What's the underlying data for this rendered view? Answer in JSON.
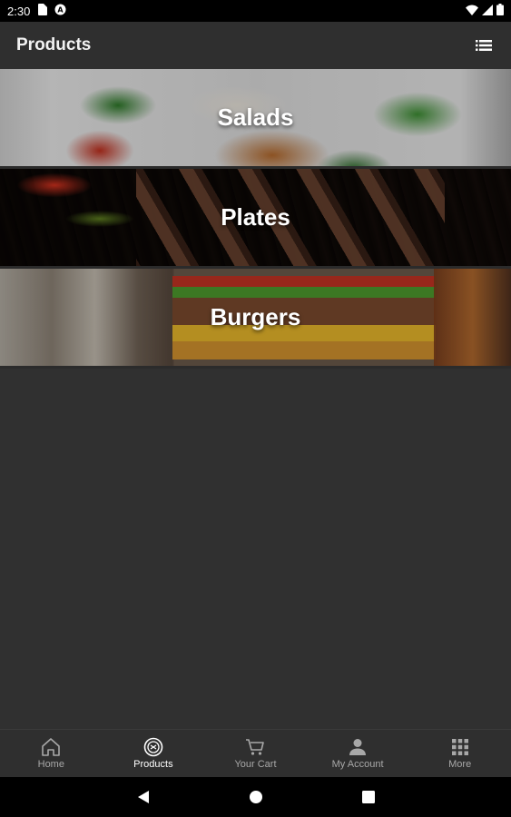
{
  "status_bar": {
    "time": "2:30",
    "icons": [
      "sim-card-icon",
      "vpn-icon",
      "wifi-icon",
      "signal-icon",
      "battery-icon"
    ]
  },
  "app_bar": {
    "title": "Products",
    "menu_icon": "list-menu-icon"
  },
  "categories": [
    {
      "label": "Salads",
      "image": "salad-photo"
    },
    {
      "label": "Plates",
      "image": "kebab-skewers-photo"
    },
    {
      "label": "Burgers",
      "image": "burger-photo"
    }
  ],
  "bottom_nav": {
    "items": [
      {
        "label": "Home",
        "icon": "home-icon",
        "active": false
      },
      {
        "label": "Products",
        "icon": "products-icon",
        "active": true
      },
      {
        "label": "Your Cart",
        "icon": "cart-icon",
        "active": false
      },
      {
        "label": "My Account",
        "icon": "account-icon",
        "active": false
      },
      {
        "label": "More",
        "icon": "grid-icon",
        "active": false
      }
    ]
  },
  "system_nav": {
    "icons": [
      "back-icon",
      "home-circle-icon",
      "recents-icon"
    ]
  },
  "colors": {
    "background": "#303030",
    "app_bar": "#2f2f2f",
    "active_nav": "#ffffff",
    "inactive_nav": "#a8a8a8"
  }
}
